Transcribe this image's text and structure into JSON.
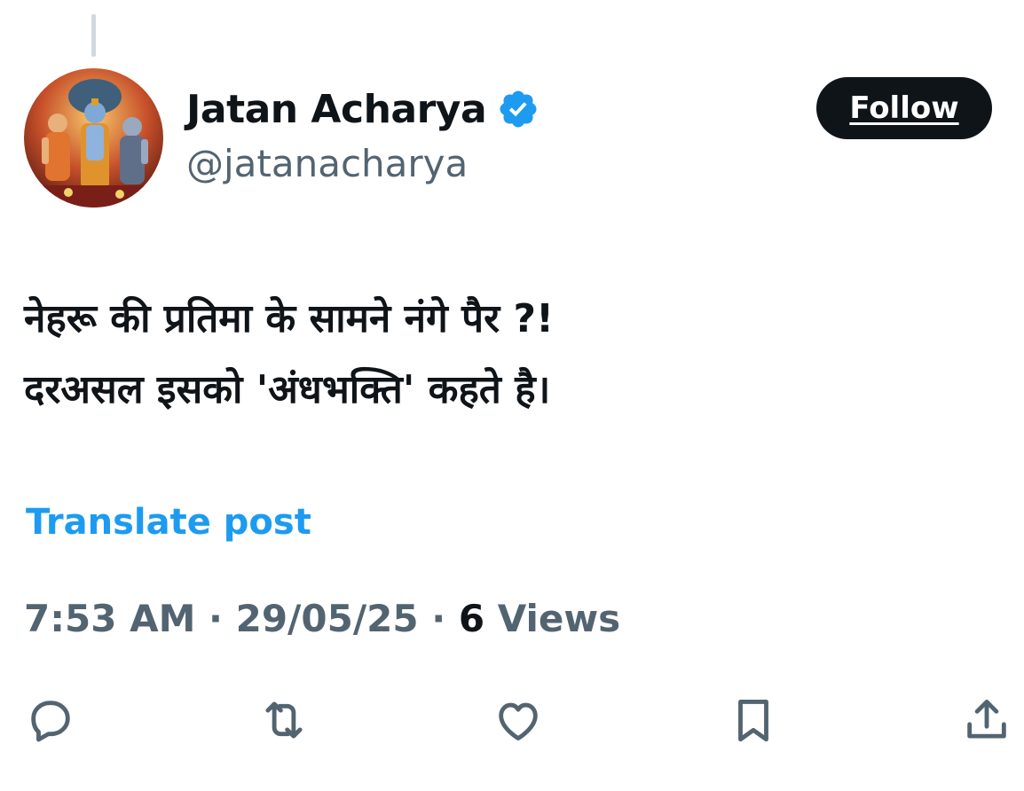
{
  "author": {
    "display_name": "Jatan Acharya",
    "handle": "@jatanacharya",
    "verified": true,
    "verified_color": "#1d9bf0"
  },
  "follow_label": "Follow",
  "post": {
    "lines": [
      "नेहरू की प्रतिमा के सामने नंगे पैर ?!",
      "दरअसल इसको 'अंधभक्ति' कहते है।"
    ]
  },
  "translate_label": "Translate post",
  "meta": {
    "time": "7:53 AM",
    "separator": "·",
    "date": "29/05/25",
    "views_count": "6",
    "views_label": "Views"
  },
  "actions": [
    {
      "icon": "reply-icon"
    },
    {
      "icon": "repost-icon"
    },
    {
      "icon": "like-icon"
    },
    {
      "icon": "bookmark-icon"
    },
    {
      "icon": "share-icon"
    }
  ],
  "colors": {
    "text": "#0f1419",
    "secondary": "#536471",
    "link": "#1d9bf0",
    "follow_bg": "#0f1419"
  }
}
